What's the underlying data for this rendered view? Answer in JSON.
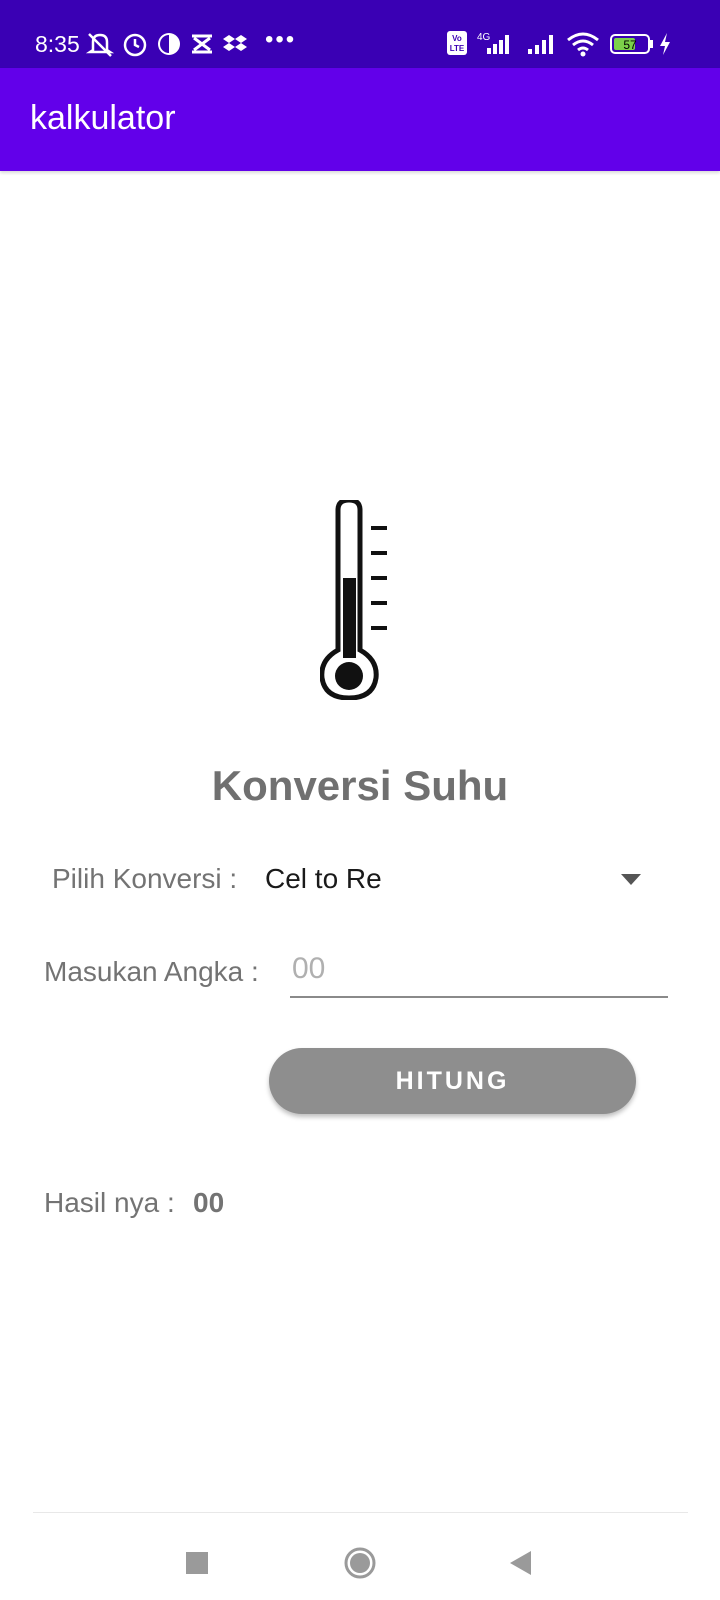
{
  "status_bar": {
    "time": "8:35",
    "battery": "57",
    "icons": [
      "mute-icon",
      "alarm-icon",
      "app-icon",
      "capcut-icon",
      "dropbox-icon",
      "volte-icon",
      "signal-4g-icon",
      "signal-icon",
      "wifi-icon",
      "battery-icon",
      "charging-icon"
    ]
  },
  "app_bar": {
    "title": "kalkulator"
  },
  "main": {
    "heading": "Konversi Suhu",
    "conversion_label": "Pilih Konversi :",
    "conversion_value": "Cel to Re",
    "input_label": "Masukan Angka :",
    "input_placeholder": "00",
    "button_label": "HITUNG",
    "result_label": "Hasil nya :",
    "result_value": "00"
  },
  "colors": {
    "status_bar": "#3a00b4",
    "app_bar": "#6200ea",
    "button": "#8e8e8e",
    "label_text": "#737373"
  }
}
